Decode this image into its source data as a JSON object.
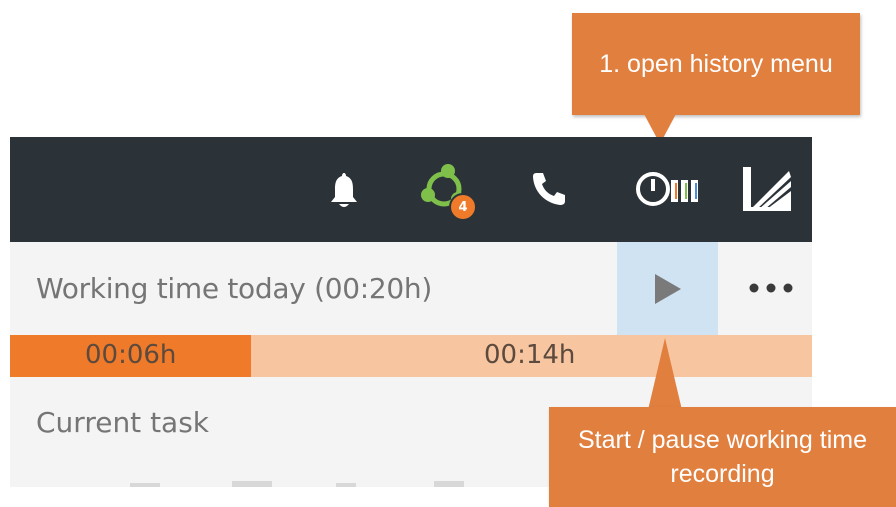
{
  "callouts": {
    "history": "1. open history menu",
    "start_pause": "Start / pause working time recording"
  },
  "topbar": {
    "icons": [
      "bell-icon",
      "network-icon",
      "phone-icon",
      "time-tracking-history-icon",
      "app-logo-icon"
    ],
    "network_badge": "4"
  },
  "widget": {
    "working_time_label": "Working time today (00:20h)",
    "play_icon": "play-icon",
    "more_icon": "more-dots-icon",
    "progress": {
      "elapsed_label": "00:06h",
      "remaining_label": "00:14h",
      "elapsed_fraction": 0.3
    },
    "current_task_label": "Current task"
  },
  "colors": {
    "topbar_bg": "#2b3339",
    "accent_orange": "#ef7a2a",
    "progress_remaining": "#f7c6a1",
    "play_button_bg": "#cfe3f3",
    "callout_bg": "#e17f3f"
  }
}
